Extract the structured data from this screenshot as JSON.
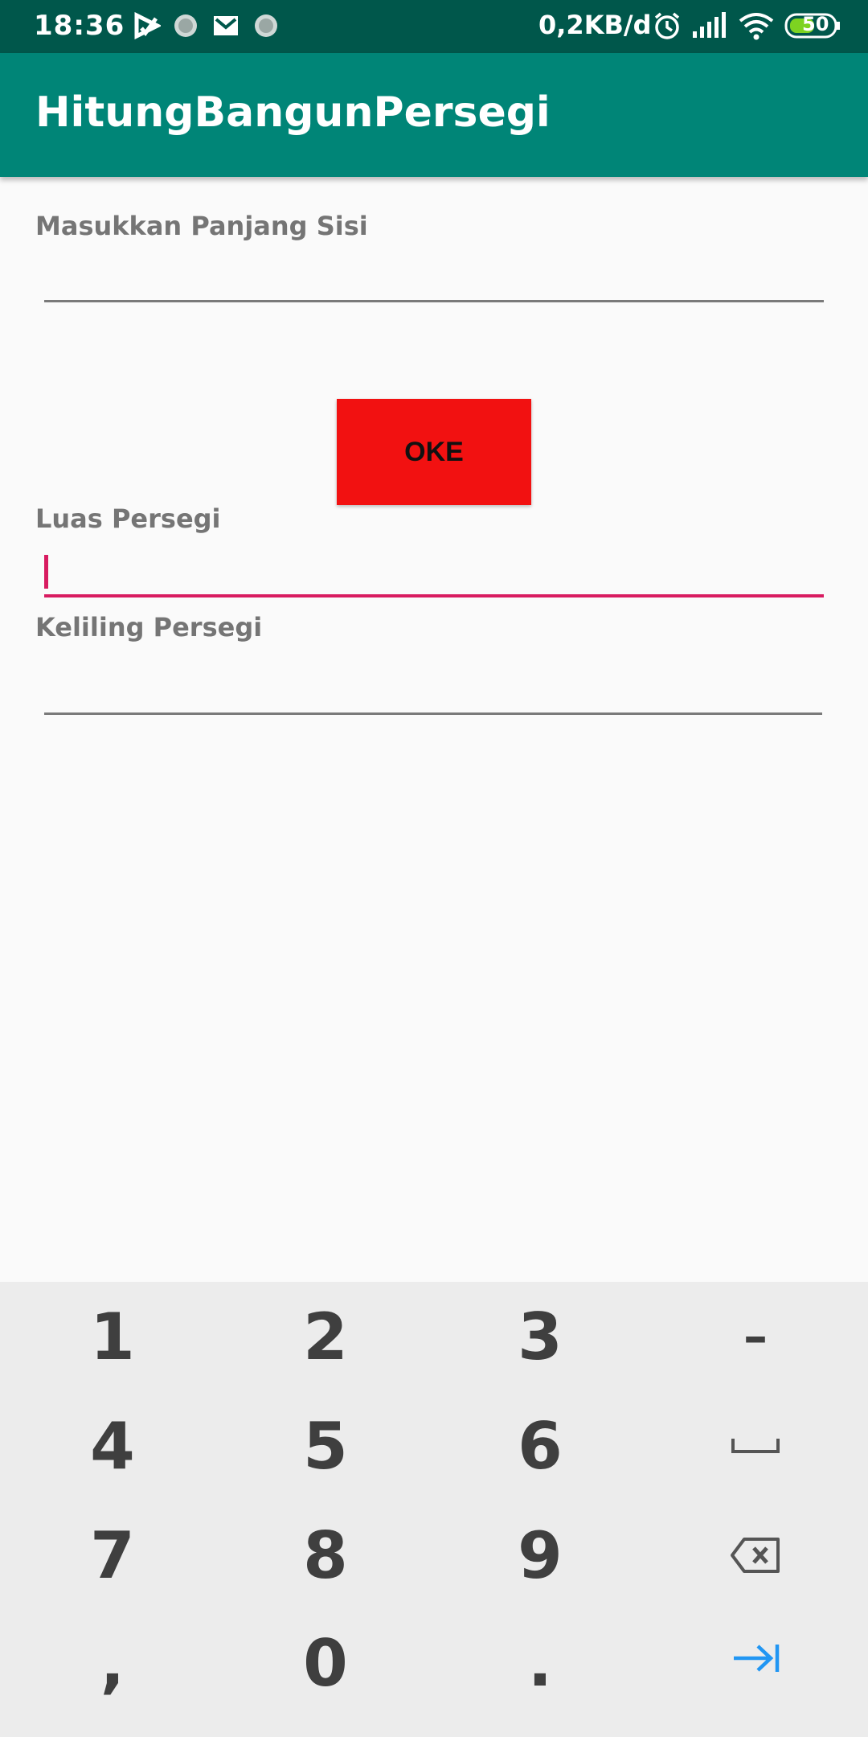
{
  "status_bar": {
    "time": "18:36",
    "network_speed": "0,2KB/d",
    "battery": "50",
    "icons": [
      "play-store-icon",
      "app-notification-icon",
      "gmail-icon",
      "app-notification-icon",
      "alarm-icon",
      "signal-icon",
      "wifi-icon",
      "battery-icon"
    ]
  },
  "app_bar": {
    "title": "HitungBangunPersegi"
  },
  "form": {
    "side_label": "Masukkan Panjang Sisi",
    "side_value": "",
    "button_label": "OKE",
    "area_label": "Luas Persegi",
    "area_value": "",
    "perimeter_label": "Keliling Persegi",
    "perimeter_value": ""
  },
  "keyboard": {
    "keys": [
      "1",
      "2",
      "3",
      "–",
      "4",
      "5",
      "6",
      "space",
      "7",
      "8",
      "9",
      "backspace",
      ",",
      "0",
      ".",
      "next"
    ]
  },
  "colors": {
    "status_bar": "#00574b",
    "app_bar": "#008577",
    "button": "#f21111",
    "accent": "#d81b60"
  }
}
